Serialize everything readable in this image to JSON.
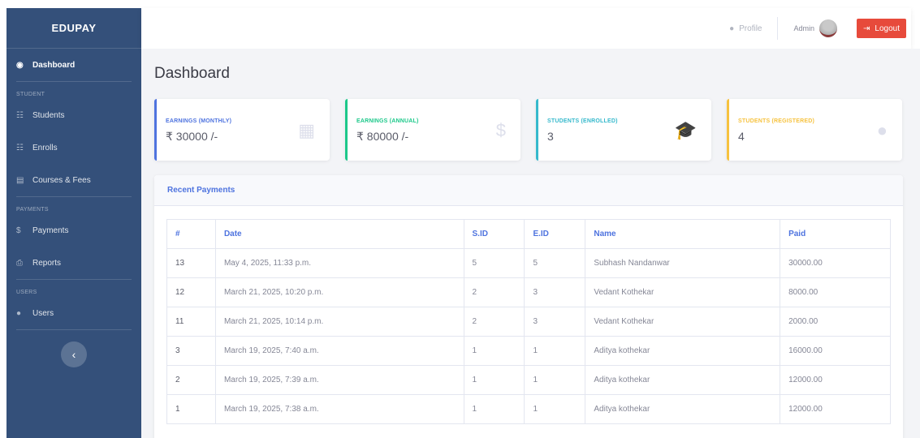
{
  "brand": "EDUPAY",
  "sidebar": {
    "dashboard": "Dashboard",
    "heading_student": "STUDENT",
    "students": "Students",
    "enrolls": "Enrolls",
    "courses_fees": "Courses & Fees",
    "heading_payments": "PAYMENTS",
    "payments": "Payments",
    "reports": "Reports",
    "heading_users": "USERS",
    "users": "Users",
    "toggle": "‹"
  },
  "topbar": {
    "profile": "Profile",
    "admin": "Admin",
    "logout": "Logout"
  },
  "page_title": "Dashboard",
  "cards": [
    {
      "label": "EARNINGS (MONTHLY)",
      "value": "₹ 30000 /-",
      "color": "#4e73df",
      "icon": "calendar-icon"
    },
    {
      "label": "EARNINGS (ANNUAL)",
      "value": "₹ 80000 /-",
      "color": "#1cc88a",
      "icon": "dollar-icon"
    },
    {
      "label": "STUDENTS (ENROLLED)",
      "value": "3",
      "color": "#36b9cc",
      "icon": "graduation-cap-icon"
    },
    {
      "label": "STUDENTS (REGISTERED)",
      "value": "4",
      "color": "#f6c23e",
      "icon": "user-icon"
    }
  ],
  "payments": {
    "title": "Recent Payments",
    "columns": [
      "#",
      "Date",
      "S.ID",
      "E.ID",
      "Name",
      "Paid"
    ],
    "rows": [
      [
        "13",
        "May 4, 2025, 11:33 p.m.",
        "5",
        "5",
        "Subhash Nandanwar",
        "30000.00"
      ],
      [
        "12",
        "March 21, 2025, 10:20 p.m.",
        "2",
        "3",
        "Vedant Kothekar",
        "8000.00"
      ],
      [
        "11",
        "March 21, 2025, 10:14 p.m.",
        "2",
        "3",
        "Vedant Kothekar",
        "2000.00"
      ],
      [
        "3",
        "March 19, 2025, 7:40 a.m.",
        "1",
        "1",
        "Aditya kothekar",
        "16000.00"
      ],
      [
        "2",
        "March 19, 2025, 7:39 a.m.",
        "1",
        "1",
        "Aditya kothekar",
        "12000.00"
      ],
      [
        "1",
        "March 19, 2025, 7:38 a.m.",
        "1",
        "1",
        "Aditya kothekar",
        "12000.00"
      ]
    ]
  }
}
